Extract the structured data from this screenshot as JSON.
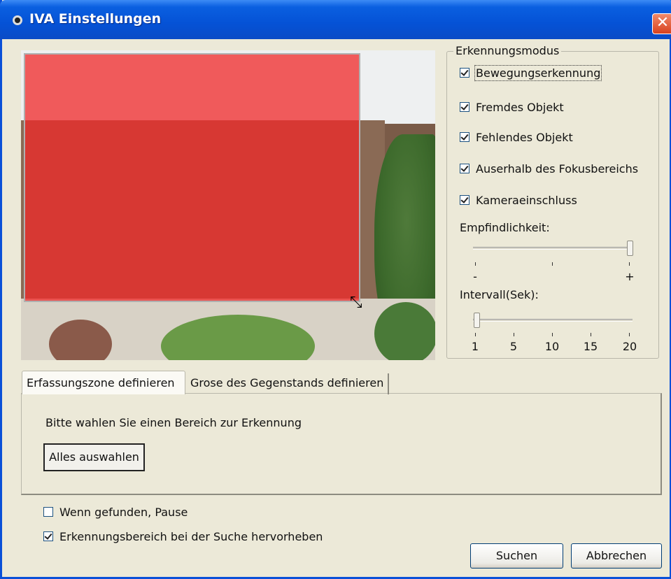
{
  "window": {
    "title": "IVA Einstellungen",
    "close_symbol": "✕"
  },
  "detection_mode": {
    "legend": "Erkennungsmodus",
    "options": [
      {
        "label": "Bewegungserkennung",
        "checked": true
      },
      {
        "label": "Fremdes Objekt",
        "checked": true
      },
      {
        "label": "Fehlendes Objekt",
        "checked": true
      },
      {
        "label": "Auserhalb des Fokusbereichs",
        "checked": true
      },
      {
        "label": "Kameraeinschluss",
        "checked": true
      }
    ],
    "sensitivity": {
      "label": "Empfindlichkeit:",
      "min_label": "-",
      "max_label": "+",
      "value": 1.0
    },
    "interval": {
      "label": "Intervall(Sek):",
      "ticks": [
        "1",
        "5",
        "10",
        "15",
        "20"
      ],
      "value": 1
    }
  },
  "tabs": [
    {
      "label": "Erfassungszone definieren",
      "active": true
    },
    {
      "label": "Grose des Gegenstands definieren",
      "active": false
    }
  ],
  "panel": {
    "instruction": "Bitte wahlen Sie einen Bereich zur Erkennung",
    "select_all_label": "Alles auswahlen"
  },
  "options": {
    "pause_when_found": {
      "label": "Wenn gefunden, Pause",
      "checked": false
    },
    "highlight_area": {
      "label": "Erkennungsbereich bei der Suche hervorheben",
      "checked": true
    }
  },
  "buttons": {
    "search": "Suchen",
    "cancel": "Abbrechen"
  },
  "colors": {
    "title_bar": "#0a5fe0",
    "detection_zone": "#f02828",
    "dialog_bg": "#ece9d8"
  }
}
